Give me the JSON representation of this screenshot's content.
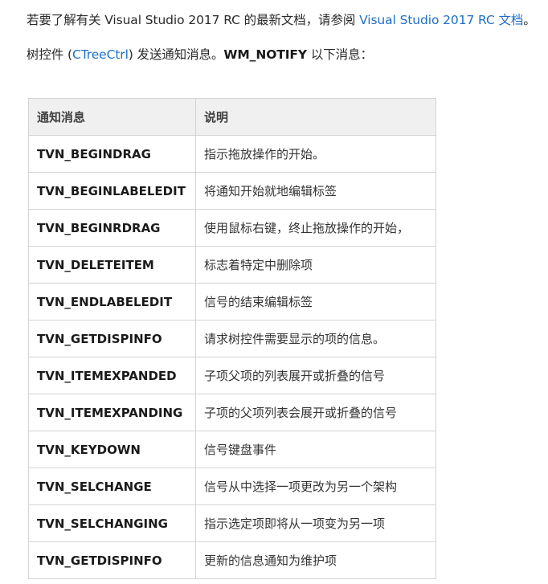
{
  "intro": {
    "line1_prefix": "若要了解有关 Visual Studio 2017 RC 的最新文档，请参阅 ",
    "line1_link": "Visual Studio 2017 RC 文档",
    "line1_suffix": "。",
    "line2_prefix": "树控件 (",
    "line2_link": "CTreeCtrl",
    "line2_middle": ") 发送通知消息。",
    "line2_strong": "WM_NOTIFY",
    "line2_suffix": " 以下消息："
  },
  "table": {
    "headers": [
      "通知消息",
      "说明"
    ],
    "rows": [
      {
        "name": "TVN_BEGINDRAG",
        "desc": "指示拖放操作的开始。"
      },
      {
        "name": "TVN_BEGINLABELEDIT",
        "desc": "将通知开始就地编辑标签"
      },
      {
        "name": "TVN_BEGINRDRAG",
        "desc": "使用鼠标右键，终止拖放操作的开始，"
      },
      {
        "name": "TVN_DELETEITEM",
        "desc": "标志着特定中删除项"
      },
      {
        "name": "TVN_ENDLABELEDIT",
        "desc": "信号的结束编辑标签"
      },
      {
        "name": "TVN_GETDISPINFO",
        "desc": "请求树控件需要显示的项的信息。"
      },
      {
        "name": "TVN_ITEMEXPANDED",
        "desc": "子项父项的列表展开或折叠的信号"
      },
      {
        "name": "TVN_ITEMEXPANDING",
        "desc": "子项的父项列表会展开或折叠的信号"
      },
      {
        "name": "TVN_KEYDOWN",
        "desc": "信号键盘事件"
      },
      {
        "name": "TVN_SELCHANGE",
        "desc": "信号从中选择一项更改为另一个架构"
      },
      {
        "name": "TVN_SELCHANGING",
        "desc": "指示选定项即将从一项变为另一项"
      },
      {
        "name": "TVN_GETDISPINFO",
        "desc": "更新的信息通知为维护项"
      }
    ]
  },
  "colors": {
    "link": "#1e6fc8",
    "header_bg": "#f0f0f0",
    "border": "#d4d4d4"
  }
}
